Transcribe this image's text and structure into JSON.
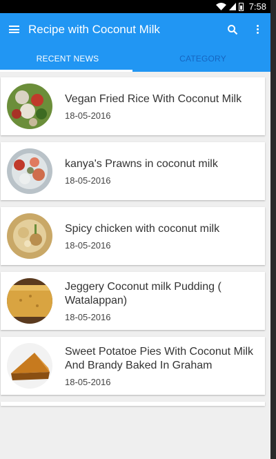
{
  "status_bar": {
    "time": "7:58"
  },
  "app_bar": {
    "title": "Recipe with Coconut Milk"
  },
  "tabs": [
    {
      "label": "RECENT NEWS",
      "active": true
    },
    {
      "label": "CATEGORY",
      "active": false
    }
  ],
  "recipes": [
    {
      "title": "Vegan Fried Rice With Coconut Milk",
      "date": "18-05-2016"
    },
    {
      "title": "kanya's Prawns in coconut milk",
      "date": "18-05-2016"
    },
    {
      "title": "Spicy chicken with coconut milk",
      "date": "18-05-2016"
    },
    {
      "title": "Jeggery Coconut milk Pudding ( Watalappan)",
      "date": "18-05-2016"
    },
    {
      "title": "Sweet Potatoe Pies With Coconut Milk And Brandy Baked In Graham",
      "date": "18-05-2016"
    }
  ],
  "colors": {
    "primary": "#2196f3",
    "tab_inactive": "#1565c0",
    "background": "#efefef"
  }
}
